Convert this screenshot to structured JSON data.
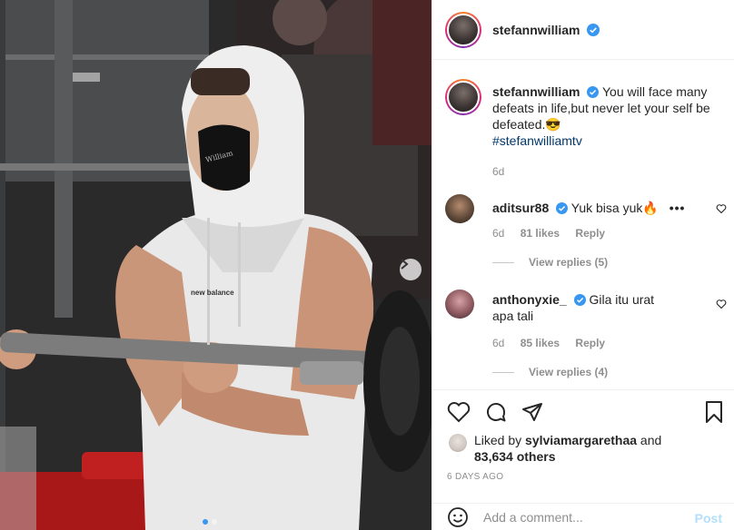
{
  "post": {
    "username": "stefannwilliam",
    "caption": "You will face many defeats in life,but never let your self be defeated.",
    "caption_emoji": "😎",
    "hashtag": "#stefanwilliamtv",
    "age": "6d"
  },
  "photo": {
    "shirt_logo": "new balance",
    "mask_text": "William"
  },
  "comments": [
    {
      "username": "aditsur88",
      "text": "Yuk bisa yuk",
      "emoji": "🔥",
      "more": "•••",
      "age": "6d",
      "likes": "81 likes",
      "reply": "Reply",
      "view_replies": "View replies (5)"
    },
    {
      "username": "anthonyxie_",
      "text": "Gila itu urat apa tali",
      "age": "6d",
      "likes": "85 likes",
      "reply": "Reply",
      "view_replies": "View replies (4)"
    }
  ],
  "actions": {
    "liked_by_prefix": "Liked by ",
    "liked_by_user": "sylviamargarethaa",
    "liked_by_mid": " and",
    "liked_by_others": "83,634 others",
    "time_ago": "6 DAYS AGO"
  },
  "add_comment": {
    "placeholder": "Add a comment...",
    "post_label": "Post"
  },
  "colors": {
    "verified": "#3897f0",
    "hashtag": "#00376b",
    "post_disabled": "#b2dffc"
  }
}
